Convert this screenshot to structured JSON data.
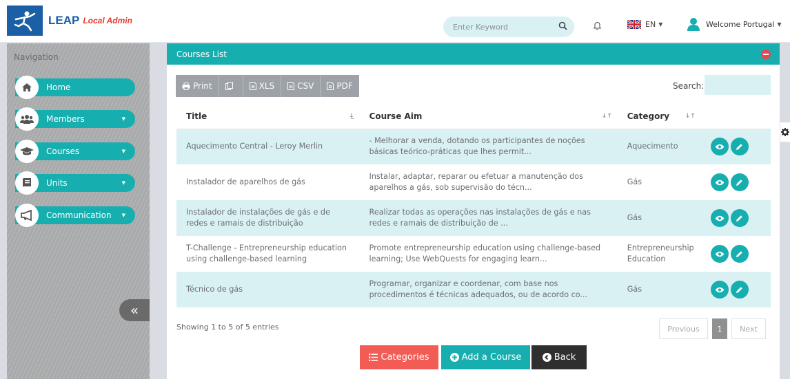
{
  "brand": {
    "name": "LEAP",
    "subtitle": "Local Admin"
  },
  "header": {
    "search_placeholder": "Enter Keyword",
    "language": "EN",
    "welcome": "Welcome Portugal"
  },
  "sidebar": {
    "title": "Navigation",
    "items": [
      {
        "label": "Home",
        "icon": "home-icon",
        "has_submenu": false
      },
      {
        "label": "Members",
        "icon": "users-icon",
        "has_submenu": true
      },
      {
        "label": "Courses",
        "icon": "graduation-cap-icon",
        "has_submenu": true
      },
      {
        "label": "Units",
        "icon": "book-icon",
        "has_submenu": true
      },
      {
        "label": "Communication",
        "icon": "megaphone-icon",
        "has_submenu": true
      }
    ],
    "collapse_symbol": "«"
  },
  "panel": {
    "title": "Courses List",
    "toolbar": {
      "print": "Print",
      "xls": "XLS",
      "csv": "CSV",
      "pdf": "PDF"
    },
    "search_label": "Search:",
    "columns": {
      "title": "Title",
      "aim": "Course Aim",
      "category": "Category"
    },
    "rows": [
      {
        "title": "Aquecimento Central - Leroy Merlin",
        "aim": "- Melhorar a venda, dotando os participantes de noções básicas teórico-práticas que lhes permit...",
        "category": "Aquecimento"
      },
      {
        "title": "Instalador de aparelhos de gás",
        "aim": "Instalar, adaptar, reparar ou efetuar a manutenção dos aparelhos a gás, sob supervisão do técn...",
        "category": "Gás"
      },
      {
        "title": "Instalador de instalações de gás e de redes e ramais de distribuição",
        "aim": "Realizar todas as operações nas instalações de gás e nas redes e ramais de distribuição de ...",
        "category": "Gás"
      },
      {
        "title": "T-Challenge - Entrepreneurship education using challenge-based learning",
        "aim": "Promote entrepreneurship education using challenge-based learning; Use WebQuests for engaging learn...",
        "category": "Entrepreneurship Education"
      },
      {
        "title": "Técnico de gás",
        "aim": "Programar, organizar e coordenar, com base nos procedimentos é técnicas adequados, ou de acordo co...",
        "category": "Gás"
      }
    ],
    "info": "Showing 1 to 5 of 5 entries",
    "pager": {
      "previous": "Previous",
      "current": "1",
      "next": "Next"
    },
    "buttons": {
      "categories": "Categories",
      "add": "Add a Course",
      "back": "Back"
    }
  },
  "colors": {
    "accent": "#17aeb0",
    "brand": "#1b5fa5",
    "danger": "#f25c55",
    "dark": "#2f2f30",
    "row_alt": "#d9f1f2"
  }
}
